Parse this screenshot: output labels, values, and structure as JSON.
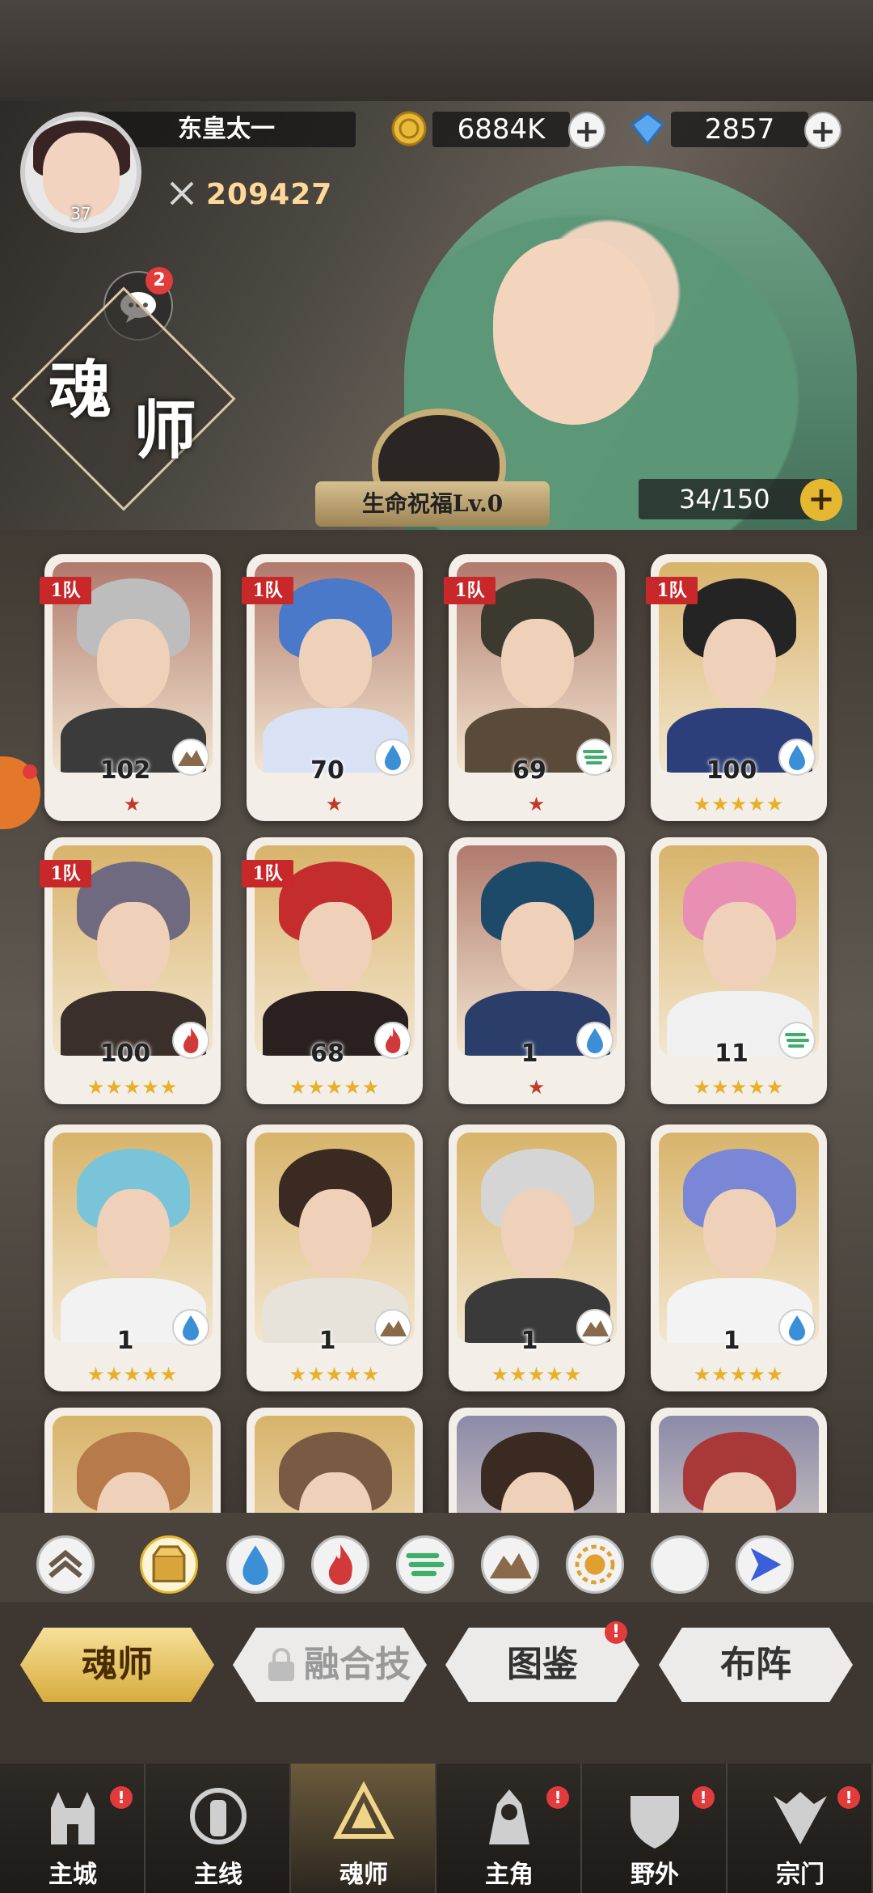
{
  "player": {
    "name": "东皇太一",
    "level": "37",
    "power": "209427"
  },
  "resources": {
    "coins": "6884K",
    "gems": "2857",
    "plus": "+"
  },
  "chat": {
    "badge": "2"
  },
  "page_title": {
    "char1": "魂",
    "char2": "师"
  },
  "hero_banner": {
    "blessing": "生命祝福Lv.0",
    "slots": "34/150",
    "slots_plus": "+"
  },
  "cards": [
    {
      "level": "102",
      "element": "earth",
      "stars": "★",
      "star_color": "red",
      "team": "1队",
      "hair": "#bdbdbd",
      "bg": "#b07a6e",
      "body": "#3b3b3b"
    },
    {
      "level": "70",
      "element": "water",
      "stars": "★",
      "star_color": "red",
      "team": "1队",
      "hair": "#4a79c9",
      "bg": "#b07a6e",
      "body": "#d9e2f5"
    },
    {
      "level": "69",
      "element": "wind",
      "stars": "★",
      "star_color": "red",
      "team": "1队",
      "hair": "#3c3a2e",
      "bg": "#b07a6e",
      "body": "#5a4a3a"
    },
    {
      "level": "100",
      "element": "water",
      "stars": "★★★★★",
      "star_color": "gold",
      "team": "1队",
      "hair": "#242424",
      "bg": "#d8b46b",
      "body": "#2c3f7a"
    },
    {
      "level": "100",
      "element": "fire",
      "stars": "★★★★★",
      "star_color": "gold",
      "team": "1队",
      "hair": "#6f6a80",
      "bg": "#d8b46b",
      "body": "#3a2f2a"
    },
    {
      "level": "68",
      "element": "fire",
      "stars": "★★★★★",
      "star_color": "gold",
      "team": "1队",
      "hair": "#c42d2d",
      "bg": "#d8b46b",
      "body": "#2a2020"
    },
    {
      "level": "1",
      "element": "water",
      "stars": "★",
      "star_color": "red",
      "team": "",
      "hair": "#1e4a6a",
      "bg": "#b07a6e",
      "body": "#2b3e6a"
    },
    {
      "level": "11",
      "element": "wind",
      "stars": "★★★★★",
      "star_color": "gold",
      "team": "",
      "hair": "#e98fb3",
      "bg": "#d8b46b",
      "body": "#f0f0f0"
    },
    {
      "level": "1",
      "element": "water",
      "stars": "★★★★★",
      "star_color": "gold",
      "team": "",
      "hair": "#7ac4d9",
      "bg": "#d8b46b",
      "body": "#f2f2f2"
    },
    {
      "level": "1",
      "element": "earth",
      "stars": "★★★★★",
      "star_color": "gold",
      "team": "",
      "hair": "#3a2a22",
      "bg": "#d8b46b",
      "body": "#e8e3da"
    },
    {
      "level": "1",
      "element": "earth",
      "stars": "★★★★★",
      "star_color": "gold",
      "team": "",
      "hair": "#d5d5d5",
      "bg": "#d8b46b",
      "body": "#3a3a3a"
    },
    {
      "level": "1",
      "element": "water",
      "stars": "★★★★★",
      "star_color": "gold",
      "team": "",
      "hair": "#7a86d6",
      "bg": "#d8b46b",
      "body": "#f3f3f3"
    },
    {
      "level": "",
      "element": "",
      "stars": "",
      "star_color": "gold",
      "team": "",
      "hair": "#b77a4a",
      "bg": "#d8b46b",
      "body": "#e9d8b8"
    },
    {
      "level": "",
      "element": "",
      "stars": "",
      "star_color": "gold",
      "team": "",
      "hair": "#7a5a42",
      "bg": "#d8b46b",
      "body": "#f0e8da"
    },
    {
      "level": "",
      "element": "",
      "stars": "",
      "star_color": "gold",
      "team": "",
      "hair": "#3a2a22",
      "bg": "#8c8aa8",
      "body": "#3a3a3a"
    },
    {
      "level": "",
      "element": "",
      "stars": "",
      "star_color": "gold",
      "team": "",
      "hair": "#a93838",
      "bg": "#8c8aa8",
      "body": "#5a2a2a"
    }
  ],
  "filters": [
    "rank",
    "all",
    "water",
    "fire",
    "wind",
    "earth",
    "light",
    "dark",
    "special"
  ],
  "tabs": [
    {
      "label": "魂师",
      "state": "active"
    },
    {
      "label": "融合技",
      "state": "locked"
    },
    {
      "label": "图鉴",
      "state": "normal",
      "badge": "!"
    },
    {
      "label": "布阵",
      "state": "normal"
    }
  ],
  "nav": [
    {
      "label": "主城",
      "icon": "castle-icon",
      "badge": "!"
    },
    {
      "label": "主线",
      "icon": "mainline-icon",
      "badge": ""
    },
    {
      "label": "魂师",
      "icon": "soul-master-icon",
      "badge": "",
      "active": true
    },
    {
      "label": "主角",
      "icon": "protagonist-icon",
      "badge": "!"
    },
    {
      "label": "野外",
      "icon": "wild-icon",
      "badge": "!"
    },
    {
      "label": "宗门",
      "icon": "sect-icon",
      "badge": "!"
    }
  ],
  "colors": {
    "accent_gold": "#e6b832",
    "badge_red": "#e23b3b",
    "team_red": "#c8282a",
    "water": "#3b8fd6",
    "fire": "#d23a3a",
    "wind": "#3fae6a",
    "earth": "#8a6a4a"
  }
}
